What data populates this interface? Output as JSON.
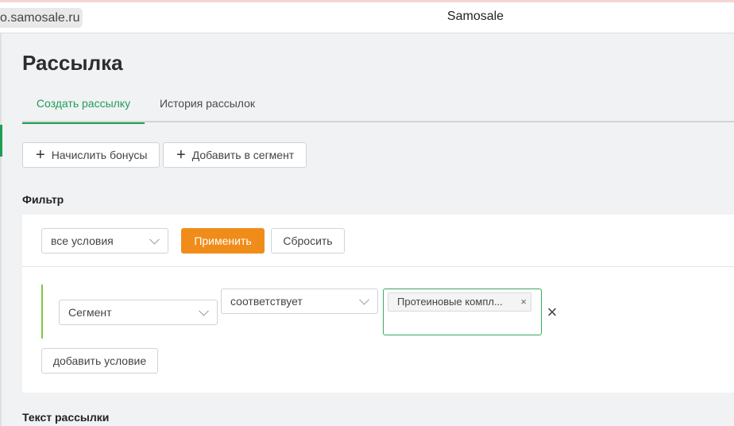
{
  "browser": {
    "url": "o.samosale.ru",
    "site_title": "Samosale"
  },
  "page": {
    "title": "Рассылка"
  },
  "tabs": [
    {
      "label": "Создать рассылку",
      "active": true
    },
    {
      "label": "История рассылок",
      "active": false
    }
  ],
  "actions": {
    "accrue_bonus": "Начислить бонусы",
    "add_to_segment": "Добавить в сегмент"
  },
  "filter": {
    "title": "Фильтр",
    "conditions_select": "все условия",
    "apply_label": "Применить",
    "reset_label": "Сбросить",
    "condition": {
      "field": "Сегмент",
      "operator": "соответствует",
      "value_tag": "Протеиновые компл...",
      "remove_symbol": "×"
    },
    "add_condition_label": "добавить условие"
  },
  "message": {
    "title": "Текст рассылки"
  },
  "colors": {
    "accent_green": "#1e9e55",
    "apply_orange": "#f08c1a",
    "condition_bar": "#7ac943",
    "background": "#f1f2f4"
  }
}
